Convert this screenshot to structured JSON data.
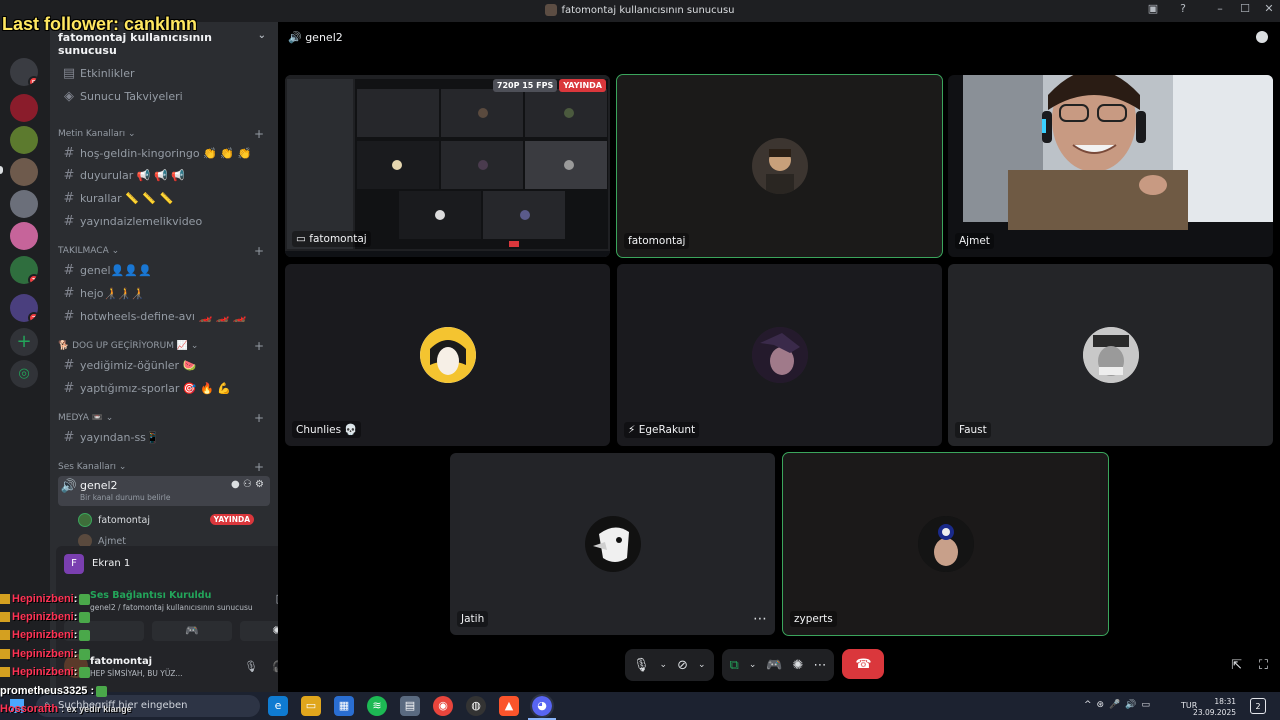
{
  "titlebar": {
    "title": "fatomontaj kullanıcısının sunucusu"
  },
  "overlay": {
    "last_follower": "Last follower: canklmn",
    "chat_lines": [
      {
        "user": "Hepinizbeni",
        "text": ":"
      },
      {
        "user": "Hepinizbeni",
        "text": ":"
      },
      {
        "user": "Hepinizbeni",
        "text": ":"
      },
      {
        "user": "Hepinizbeni",
        "text": ":"
      },
      {
        "user": "Hepinizbeni",
        "text": ":"
      }
    ],
    "chat_last_user": "prometheus3325",
    "chat_last_text": ":",
    "chat_bottom_user": "Hossorafth",
    "chat_bottom_text": ": ex yedir kiange"
  },
  "rail": {
    "badges": [
      "5",
      "1",
      "3"
    ]
  },
  "server": {
    "name": "fatomontaj kullanıcısının sunucusu",
    "events_label": "Etkinlikler",
    "boost_label": "Sunucu Takviyeleri"
  },
  "categories": {
    "text_channels": "Metin Kanalları",
    "takilmaca": "TAKILMACA",
    "dog_up": "🐕 DOG UP GEÇİRİYORUM 📈",
    "medya": "MEDYA 📼",
    "voice_channels": "Ses Kanalları"
  },
  "channels": {
    "welcome": "hoş-geldin-kingoringo 👏 👏 👏",
    "announcements": "duyurular 📢 📢 📢",
    "rules": "kurallar 📏 📏 📏",
    "video": "yayındaizlemelikvideo",
    "genel": "genel👤👤👤",
    "hejo": "hejo🧑‍🦯🧑‍🦯🧑‍🦯",
    "hotwheels": "hotwheels-define-avı 🏎️ 🏎️ 🏎️",
    "food": "yediğimiz-öğünler 🍉",
    "sports": "yaptığımız-sporlar 🎯 🔥 💪",
    "stream_ss": "yayından-ss📱"
  },
  "voice": {
    "channel": "genel2",
    "status_hint": "Bir kanal durumu belirle",
    "users": [
      {
        "name": "fatomontaj",
        "live": "YAYINDA"
      },
      {
        "name": "Ajmet"
      }
    ]
  },
  "panel": {
    "screen_label": "Ekran 1",
    "connection_status": "Ses Bağlantısı Kuruldu",
    "connection_detail": "genel2 / fatomontaj kullanıcısının sunucusu",
    "user_name": "fatomontaj",
    "user_status": "HEP SİMSİYAH, BU YÜZ..."
  },
  "main": {
    "channel_title": "genel2",
    "stream_badges": {
      "quality": "720P 15 FPS",
      "live": "YAYINDA"
    },
    "tiles": [
      {
        "name": "fatomontaj",
        "type": "stream"
      },
      {
        "name": "fatomontaj",
        "type": "avatar"
      },
      {
        "name": "Ajmet",
        "type": "camera"
      },
      {
        "name": "Chunlies 💀",
        "type": "avatar"
      },
      {
        "name": "EgeRakunt",
        "type": "avatar"
      },
      {
        "name": "Faust",
        "type": "avatar"
      },
      {
        "name": "Jatih",
        "type": "avatar"
      },
      {
        "name": "zyperts",
        "type": "avatar"
      }
    ]
  },
  "taskbar": {
    "search_placeholder": "Suchbegriff hier eingeben",
    "lang": "TUR",
    "time": "18:31",
    "date": "23.09.2025",
    "notifications": "2"
  },
  "colors": {
    "accent_green": "#3ba55c",
    "live_red": "#da373c",
    "brand": "#5865f2"
  }
}
